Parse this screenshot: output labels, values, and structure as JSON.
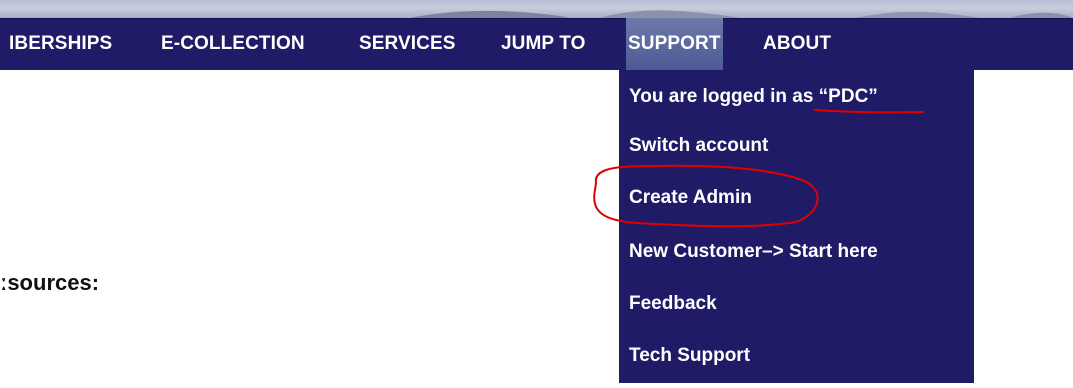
{
  "nav": {
    "items": [
      {
        "label": "IBERSHIPS"
      },
      {
        "label": "E-COLLECTION"
      },
      {
        "label": "SERVICES"
      },
      {
        "label": "JUMP TO"
      },
      {
        "label": "SUPPORT"
      },
      {
        "label": "ABOUT"
      }
    ]
  },
  "support_menu": {
    "items": [
      {
        "label": "You are logged in as “PDC”"
      },
      {
        "label": "Switch account"
      },
      {
        "label": "Create Admin"
      },
      {
        "label": "New Customer–> Start here"
      },
      {
        "label": "Feedback"
      },
      {
        "label": "Tech Support"
      }
    ]
  },
  "content": {
    "resources_label": "ːsources:"
  },
  "colors": {
    "nav_background": "#1f1b67",
    "active_tab": "#5b67a3",
    "annotation": "#e00000"
  }
}
